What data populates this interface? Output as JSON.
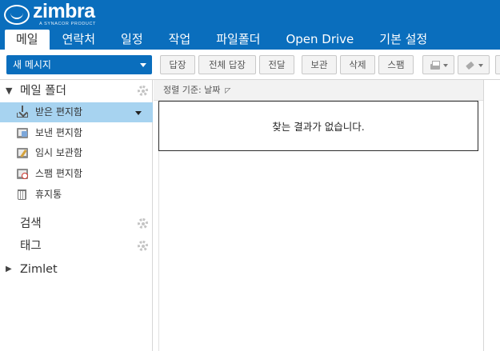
{
  "app": {
    "logo_word": "zimbra",
    "logo_sub": "A SYNACOR PRODUCT"
  },
  "tabs": [
    {
      "label": "메일",
      "active": true
    },
    {
      "label": "연락처"
    },
    {
      "label": "일정"
    },
    {
      "label": "작업"
    },
    {
      "label": "파일폴더"
    },
    {
      "label": "Open Drive"
    },
    {
      "label": "기본 설정"
    }
  ],
  "toolbar": {
    "new_message": "새 메시지",
    "reply": "답장",
    "reply_all": "전체 답장",
    "forward": "전달",
    "archive": "보관",
    "delete": "삭제",
    "spam": "스팸"
  },
  "sidebar": {
    "mail_folders_label": "메일 폴더",
    "folders": [
      {
        "label": "받은 편지함",
        "icon": "inbox-icon",
        "selected": true
      },
      {
        "label": "보낸 편지함",
        "icon": "sent-folder-icon"
      },
      {
        "label": "임시 보관함",
        "icon": "drafts-folder-icon"
      },
      {
        "label": "스팸 편지함",
        "icon": "junk-folder-icon"
      },
      {
        "label": "휴지통",
        "icon": "trash-icon"
      }
    ],
    "search_label": "검색",
    "tags_label": "태그",
    "zimlet_label": "Zimlet"
  },
  "main": {
    "sort_label": "정렬 기준: 날짜",
    "empty_message": "찾는 결과가 없습니다."
  },
  "colors": {
    "header_bg": "#0a6ebd",
    "selected_folder_bg": "#a7d3f0"
  }
}
